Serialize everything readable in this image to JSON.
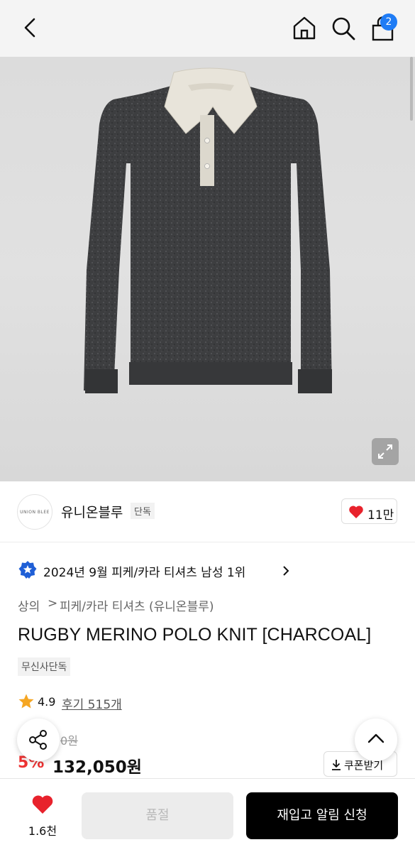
{
  "header": {
    "cart_count": "2",
    "icons": [
      "back-icon",
      "home-icon",
      "search-icon",
      "shopping-bag-icon"
    ]
  },
  "product_image": {
    "description_icons": [
      "expand-icon"
    ]
  },
  "brand": {
    "logo_text": "UNION BLEE",
    "name": "유니온블루",
    "tag": "단독",
    "likes": "11만"
  },
  "ranking": {
    "text": "2024년 9월 피케/카라 티셔츠 남성 1위"
  },
  "breadcrumb": {
    "level1": "상의",
    "separator": ">",
    "level2": "피케/카라 티셔츠 (유니온블루)"
  },
  "product": {
    "title": "RUGBY MERINO POLO KNIT [CHARCOAL]",
    "badge": "무신사단독",
    "rating": "4.9",
    "review_label": "후기 515개",
    "original_price": "0원",
    "discount": "5%",
    "sale_price": "132,050원",
    "coupon_label": "쿠폰받기"
  },
  "bottom_bar": {
    "wish_count": "1.6천",
    "soldout_label": "품절",
    "restock_label": "재입고 알림 신청"
  },
  "colors": {
    "badge_blue": "#1f7cf5",
    "heart_red": "#e8222c",
    "discount_red": "#e33333",
    "star_orange": "#f5a623"
  }
}
